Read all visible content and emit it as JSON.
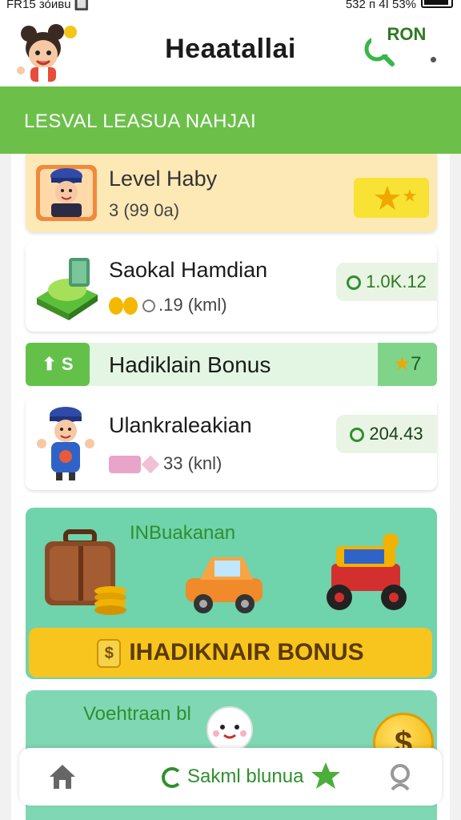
{
  "status_bar": {
    "left_text": "FR15 зо́ивu 🔲",
    "right_text": "532 ᴨ 4I  53%"
  },
  "header": {
    "title": "Heaatallai"
  },
  "banner": {
    "text": "LESVAL  LEASUA NAHJAI",
    "button_label": "RON"
  },
  "level_card": {
    "title": "Level Haby",
    "subtitle": "3 (99 0a)"
  },
  "shop_card": {
    "title": "Saokal Hamdian",
    "subtitle": ".19 (kml)",
    "badge": "1.0K.12"
  },
  "bonus_strip": {
    "tag": "⬆ S",
    "title": "Hadiklain Bonus",
    "count": "7"
  },
  "user_card": {
    "title": "Ulankraleakian",
    "subtitle": "33 (knl)",
    "badge": "204.43"
  },
  "promo": {
    "title": "INBuakanan",
    "button_label": "IHADIKNAIR BONUS"
  },
  "promo2": {
    "title": "Voehtraan bl"
  },
  "fab": {
    "label": "$"
  },
  "bottom_nav": {
    "center_label": "Sakml blunua"
  },
  "colors": {
    "brand_green": "#6cc04a",
    "accent_yellow": "#f8c51e",
    "teal": "#6fd3ab"
  }
}
